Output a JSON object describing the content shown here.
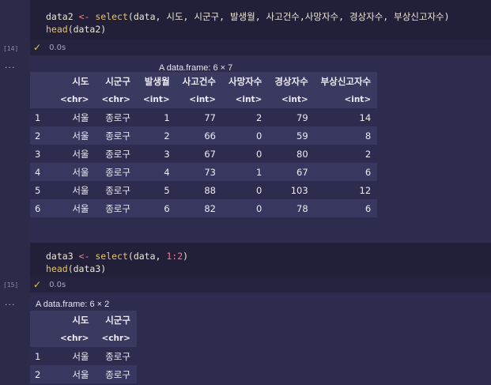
{
  "cell1": {
    "exec_count": "[14]",
    "code_line1": {
      "var": "data2",
      "op": "<-",
      "fn": "select",
      "args": "(data, 시도, 시군구, 발생월, 사고건수,사망자수, 경상자수, 부상신고자수)"
    },
    "code_line2": {
      "fn": "head",
      "args": "(data2)"
    },
    "status": {
      "check": "✓",
      "time": "0.0s"
    },
    "output": {
      "marker": "...",
      "caption": "A data.frame: 6 × 7",
      "columns": [
        "시도",
        "시군구",
        "발생월",
        "사고건수",
        "사망자수",
        "경상자수",
        "부상신고자수"
      ],
      "types": [
        "<chr>",
        "<chr>",
        "<int>",
        "<int>",
        "<int>",
        "<int>",
        "<int>"
      ],
      "rows": [
        [
          "1",
          "서울",
          "종로구",
          "1",
          "77",
          "2",
          "79",
          "14"
        ],
        [
          "2",
          "서울",
          "종로구",
          "2",
          "66",
          "0",
          "59",
          "8"
        ],
        [
          "3",
          "서울",
          "종로구",
          "3",
          "67",
          "0",
          "80",
          "2"
        ],
        [
          "4",
          "서울",
          "종로구",
          "4",
          "73",
          "1",
          "67",
          "6"
        ],
        [
          "5",
          "서울",
          "종로구",
          "5",
          "88",
          "0",
          "103",
          "12"
        ],
        [
          "6",
          "서울",
          "종로구",
          "6",
          "82",
          "0",
          "78",
          "6"
        ]
      ]
    }
  },
  "cell2": {
    "exec_count": "[15]",
    "code_line1": {
      "var": "data3",
      "op": "<-",
      "fn": "select",
      "args_pre": "(data, ",
      "num": "1:2",
      "args_post": ")"
    },
    "code_line2": {
      "fn": "head",
      "args": "(data3)"
    },
    "status": {
      "check": "✓",
      "time": "0.0s"
    },
    "output": {
      "marker": "...",
      "caption": "A data.frame: 6 × 2",
      "columns": [
        "시도",
        "시군구"
      ],
      "types": [
        "<chr>",
        "<chr>"
      ],
      "rows": [
        [
          "1",
          "서울",
          "종로구"
        ],
        [
          "2",
          "서울",
          "종로구"
        ]
      ]
    }
  }
}
